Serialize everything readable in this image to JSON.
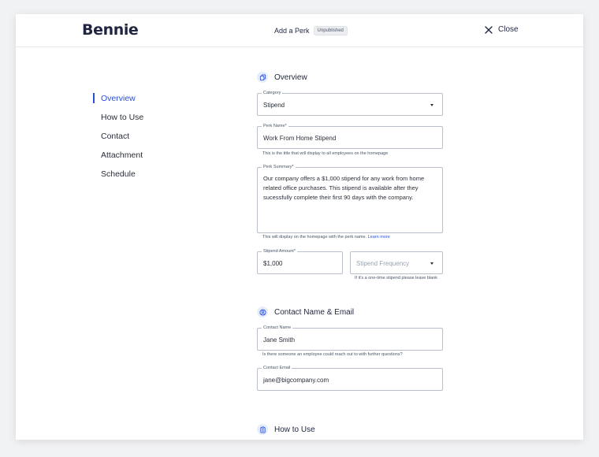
{
  "header": {
    "logo": "Bennie",
    "title": "Add a Perk",
    "status_badge": "Unpublished",
    "close_label": "Close"
  },
  "sidenav": {
    "items": [
      {
        "label": "Overview",
        "active": true
      },
      {
        "label": "How to Use",
        "active": false
      },
      {
        "label": "Contact",
        "active": false
      },
      {
        "label": "Attachment",
        "active": false
      },
      {
        "label": "Schedule",
        "active": false
      }
    ]
  },
  "overview": {
    "title": "Overview",
    "category": {
      "label": "Category",
      "value": "Stipend"
    },
    "perk_name": {
      "label": "Perk Name*",
      "value": "Work From Home Stipend",
      "helper": "This is the title that will display to all employees on the homepage"
    },
    "perk_summary": {
      "label": "Perk Summary*",
      "value": "Our company offers a $1,000 stipend for any work from home related office purchases. This stipend is available after they sucessfully complete their first 90 days with the company.",
      "helper": "This will display on the homepage with the perk name.",
      "helper_link": "Learn more"
    },
    "stipend_amount": {
      "label": "Stipend Amount*",
      "value": "$1,000"
    },
    "stipend_frequency": {
      "placeholder": "Stipend Frequency",
      "helper": "If it's a one-time stipend please leave blank"
    }
  },
  "contact": {
    "title": "Contact Name & Email",
    "name": {
      "label": "Contact Name",
      "value": "Jane Smith",
      "helper": "Is there someone an employee could reach out to with further questions?"
    },
    "email": {
      "label": "Contact Email",
      "value": "jane@bigcompany.com"
    }
  },
  "how_to_use": {
    "title": "How to Use"
  },
  "colors": {
    "accent": "#2c4fd6",
    "text": "#1f2540",
    "border": "#b9bfc9"
  }
}
